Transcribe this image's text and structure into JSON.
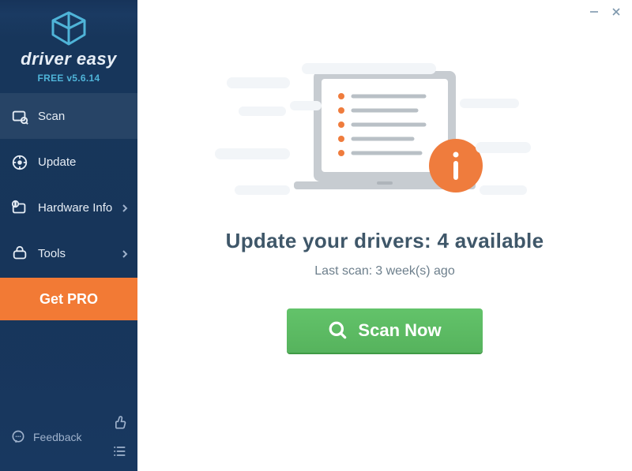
{
  "brand": {
    "name": "driver easy",
    "version_line": "FREE v5.6.14"
  },
  "sidebar": {
    "items": [
      {
        "label": "Scan",
        "icon": "scan-icon",
        "has_submenu": false,
        "active": true
      },
      {
        "label": "Update",
        "icon": "update-icon",
        "has_submenu": false,
        "active": false
      },
      {
        "label": "Hardware Info",
        "icon": "hardware-icon",
        "has_submenu": true,
        "active": false
      },
      {
        "label": "Tools",
        "icon": "tools-icon",
        "has_submenu": true,
        "active": false
      }
    ],
    "get_pro_label": "Get PRO",
    "feedback_label": "Feedback"
  },
  "main": {
    "headline_prefix": "Update your drivers: ",
    "available_count": "4",
    "headline_suffix": " available",
    "last_scan_prefix": "Last scan: ",
    "last_scan_value": "3 week(s) ago",
    "scan_button_label": "Scan Now"
  },
  "colors": {
    "sidebar_bg": "#17355a",
    "accent_orange": "#f27a35",
    "scan_green": "#5bbb62",
    "info_orange": "#ee7c3d",
    "text_dark": "#3f5769"
  }
}
